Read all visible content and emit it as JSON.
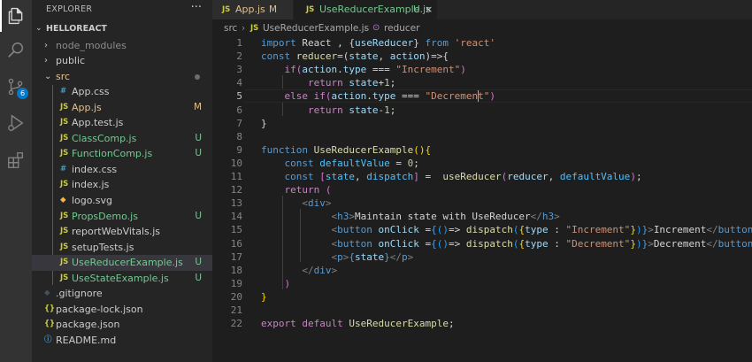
{
  "explorer": {
    "title": "EXPLORER",
    "more": "···",
    "section": "HELLOREACT"
  },
  "activity": {
    "icons": [
      "files-icon",
      "search-icon",
      "source-control-icon",
      "run-debug-icon",
      "extensions-icon"
    ],
    "scm_badge": "6"
  },
  "tree": [
    {
      "name": "node_modules",
      "type": "folder",
      "indent": 1,
      "status": "",
      "color": "#8c8c8c"
    },
    {
      "name": "public",
      "type": "folder",
      "indent": 1,
      "status": "",
      "color": "#cccccc"
    },
    {
      "name": "src",
      "type": "folder-open",
      "indent": 1,
      "status": "dot",
      "color": "#e2c08d"
    },
    {
      "name": "App.css",
      "type": "css",
      "indent": 2,
      "status": "",
      "color": "#cccccc"
    },
    {
      "name": "App.js",
      "type": "js",
      "indent": 2,
      "status": "M",
      "color": "#e2c08d"
    },
    {
      "name": "App.test.js",
      "type": "js",
      "indent": 2,
      "status": "",
      "color": "#cccccc"
    },
    {
      "name": "ClassComp.js",
      "type": "js",
      "indent": 2,
      "status": "U",
      "color": "#73c991"
    },
    {
      "name": "FunctionComp.js",
      "type": "js",
      "indent": 2,
      "status": "U",
      "color": "#73c991"
    },
    {
      "name": "index.css",
      "type": "css",
      "indent": 2,
      "status": "",
      "color": "#cccccc"
    },
    {
      "name": "index.js",
      "type": "js",
      "indent": 2,
      "status": "",
      "color": "#cccccc"
    },
    {
      "name": "logo.svg",
      "type": "svg",
      "indent": 2,
      "status": "",
      "color": "#cccccc"
    },
    {
      "name": "PropsDemo.js",
      "type": "js",
      "indent": 2,
      "status": "U",
      "color": "#73c991"
    },
    {
      "name": "reportWebVitals.js",
      "type": "js",
      "indent": 2,
      "status": "",
      "color": "#cccccc"
    },
    {
      "name": "setupTests.js",
      "type": "js",
      "indent": 2,
      "status": "",
      "color": "#cccccc"
    },
    {
      "name": "UseReducerExample.js",
      "type": "js",
      "indent": 2,
      "status": "U",
      "color": "#73c991",
      "selected": true
    },
    {
      "name": "UseStateExample.js",
      "type": "js",
      "indent": 2,
      "status": "U",
      "color": "#73c991"
    },
    {
      "name": ".gitignore",
      "type": "git",
      "indent": 1,
      "status": "",
      "color": "#cccccc"
    },
    {
      "name": "package-lock.json",
      "type": "json",
      "indent": 1,
      "status": "",
      "color": "#cccccc"
    },
    {
      "name": "package.json",
      "type": "json",
      "indent": 1,
      "status": "",
      "color": "#cccccc"
    },
    {
      "name": "README.md",
      "type": "md",
      "indent": 1,
      "status": "",
      "color": "#cccccc"
    }
  ],
  "tabs": [
    {
      "icon": "JS",
      "label": "App.js",
      "status": "M",
      "active": false
    },
    {
      "icon": "JS",
      "label": "UseReducerExample.js",
      "status": "U",
      "active": true,
      "close": "×"
    }
  ],
  "breadcrumb": {
    "folder": "src",
    "file_icon": "JS",
    "file": "UseReducerExample.js",
    "symbol_icon": "⊙",
    "symbol": "reducer",
    "sep": "›"
  },
  "editor": {
    "current_line": 5,
    "lines": [
      [
        [
          "k",
          "import"
        ],
        [
          "p",
          " React , {"
        ],
        [
          "v",
          "useReducer"
        ],
        [
          "p",
          "} "
        ],
        [
          "k",
          "from"
        ],
        [
          "p",
          " "
        ],
        [
          "s",
          "'react'"
        ]
      ],
      [
        [
          "k",
          "const"
        ],
        [
          "p",
          " "
        ],
        [
          "f",
          "reducer"
        ],
        [
          "p",
          "=("
        ],
        [
          "v",
          "state"
        ],
        [
          "p",
          ", "
        ],
        [
          "v",
          "action"
        ],
        [
          "p",
          ")=>{"
        ]
      ],
      [
        [
          "p",
          "    "
        ],
        [
          "kc",
          "if"
        ],
        [
          "br2",
          "("
        ],
        [
          "v",
          "action"
        ],
        [
          "p",
          "."
        ],
        [
          "v",
          "type"
        ],
        [
          "p",
          " === "
        ],
        [
          "s",
          "\"Increment\""
        ],
        [
          "br2",
          ")"
        ]
      ],
      [
        [
          "p",
          "        "
        ],
        [
          "kc",
          "return"
        ],
        [
          "p",
          " "
        ],
        [
          "v",
          "state"
        ],
        [
          "p",
          "+"
        ],
        [
          "n",
          "1"
        ],
        [
          "p",
          ";"
        ]
      ],
      [
        [
          "p",
          "    "
        ],
        [
          "kc",
          "else"
        ],
        [
          "p",
          " "
        ],
        [
          "kc",
          "if"
        ],
        [
          "br2",
          "("
        ],
        [
          "v",
          "action"
        ],
        [
          "p",
          "."
        ],
        [
          "v",
          "type"
        ],
        [
          "p",
          " === "
        ],
        [
          "s",
          "\"Decrement\""
        ],
        [
          "br2",
          ")"
        ]
      ],
      [
        [
          "p",
          "        "
        ],
        [
          "kc",
          "return"
        ],
        [
          "p",
          " "
        ],
        [
          "v",
          "state"
        ],
        [
          "p",
          "-"
        ],
        [
          "n",
          "1"
        ],
        [
          "p",
          ";"
        ]
      ],
      [
        [
          "p",
          "}"
        ]
      ],
      [],
      [
        [
          "k",
          "function"
        ],
        [
          "p",
          " "
        ],
        [
          "f",
          "UseReducerExample"
        ],
        [
          "br1",
          "()"
        ],
        [
          "br1",
          "{"
        ]
      ],
      [
        [
          "p",
          "    "
        ],
        [
          "k",
          "const"
        ],
        [
          "p",
          " "
        ],
        [
          "c",
          "defaultValue"
        ],
        [
          "p",
          " = "
        ],
        [
          "n",
          "0"
        ],
        [
          "p",
          ";"
        ]
      ],
      [
        [
          "p",
          "    "
        ],
        [
          "k",
          "const"
        ],
        [
          "p",
          " "
        ],
        [
          "br2",
          "["
        ],
        [
          "c",
          "state"
        ],
        [
          "p",
          ", "
        ],
        [
          "c",
          "dispatch"
        ],
        [
          "br2",
          "]"
        ],
        [
          "p",
          " =  "
        ],
        [
          "f",
          "useReducer"
        ],
        [
          "br2",
          "("
        ],
        [
          "v",
          "reducer"
        ],
        [
          "p",
          ", "
        ],
        [
          "c",
          "defaultValue"
        ],
        [
          "br2",
          ")"
        ],
        [
          "p",
          ";"
        ]
      ],
      [
        [
          "p",
          "    "
        ],
        [
          "kc",
          "return"
        ],
        [
          "p",
          " "
        ],
        [
          "br2",
          "("
        ]
      ],
      [
        [
          "p",
          "       "
        ],
        [
          "tg",
          "<"
        ],
        [
          "t",
          "div"
        ],
        [
          "tg",
          ">"
        ]
      ],
      [
        [
          "p",
          "            "
        ],
        [
          "tg",
          "<"
        ],
        [
          "t",
          "h3"
        ],
        [
          "tg",
          ">"
        ],
        [
          "p",
          "Maintain state with UseReducer"
        ],
        [
          "tg",
          "</"
        ],
        [
          "t",
          "h3"
        ],
        [
          "tg",
          ">"
        ]
      ],
      [
        [
          "p",
          "            "
        ],
        [
          "tg",
          "<"
        ],
        [
          "t",
          "button"
        ],
        [
          "p",
          " "
        ],
        [
          "v",
          "onClick"
        ],
        [
          "p",
          " ="
        ],
        [
          "k",
          "{"
        ],
        [
          "br3",
          "()"
        ],
        [
          "p",
          "=> "
        ],
        [
          "f",
          "dispatch"
        ],
        [
          "br3",
          "("
        ],
        [
          "br1",
          "{"
        ],
        [
          "v",
          "type"
        ],
        [
          "p",
          " : "
        ],
        [
          "s",
          "\"Increment\""
        ],
        [
          "br1",
          "}"
        ],
        [
          "br3",
          ")"
        ],
        [
          "k",
          "}"
        ],
        [
          "tg",
          ">"
        ],
        [
          "p",
          "Increment"
        ],
        [
          "tg",
          "</"
        ],
        [
          "t",
          "button"
        ],
        [
          "tg",
          ">"
        ]
      ],
      [
        [
          "p",
          "            "
        ],
        [
          "tg",
          "<"
        ],
        [
          "t",
          "button"
        ],
        [
          "p",
          " "
        ],
        [
          "v",
          "onClick"
        ],
        [
          "p",
          " ="
        ],
        [
          "k",
          "{"
        ],
        [
          "br3",
          "()"
        ],
        [
          "p",
          "=> "
        ],
        [
          "f",
          "dispatch"
        ],
        [
          "br3",
          "("
        ],
        [
          "br1",
          "{"
        ],
        [
          "v",
          "type"
        ],
        [
          "p",
          " : "
        ],
        [
          "s",
          "\"Decrement\""
        ],
        [
          "br1",
          "}"
        ],
        [
          "br3",
          ")"
        ],
        [
          "k",
          "}"
        ],
        [
          "tg",
          ">"
        ],
        [
          "p",
          "Decrement"
        ],
        [
          "tg",
          "</"
        ],
        [
          "t",
          "button"
        ],
        [
          "tg",
          ">"
        ]
      ],
      [
        [
          "p",
          "            "
        ],
        [
          "tg",
          "<"
        ],
        [
          "t",
          "p"
        ],
        [
          "tg",
          ">"
        ],
        [
          "k",
          "{"
        ],
        [
          "v",
          "state"
        ],
        [
          "k",
          "}"
        ],
        [
          "tg",
          "</"
        ],
        [
          "t",
          "p"
        ],
        [
          "tg",
          ">"
        ]
      ],
      [
        [
          "p",
          "       "
        ],
        [
          "tg",
          "</"
        ],
        [
          "t",
          "div"
        ],
        [
          "tg",
          ">"
        ]
      ],
      [
        [
          "p",
          "    "
        ],
        [
          "br2",
          ")"
        ]
      ],
      [
        [
          "br1",
          "}"
        ]
      ],
      [],
      [
        [
          "kc",
          "export"
        ],
        [
          "p",
          " "
        ],
        [
          "kc",
          "default"
        ],
        [
          "p",
          " "
        ],
        [
          "f",
          "UseReducerExample"
        ],
        [
          "p",
          ";"
        ]
      ]
    ]
  },
  "colors": {
    "js_icon": "#cbcb41",
    "css_icon": "#519aba",
    "json_icon": "#cbcb41",
    "md_icon": "#519aba",
    "svg_icon": "#ffb13b",
    "git_icon": "#41535b",
    "untracked": "#73c991",
    "modified": "#e2c08d"
  }
}
